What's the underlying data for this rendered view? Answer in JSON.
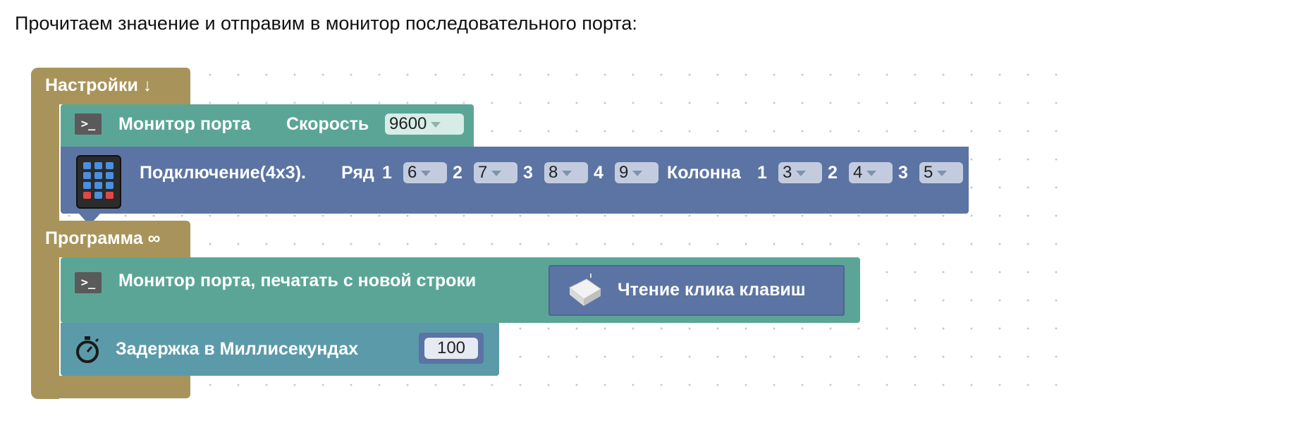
{
  "intro_text": "Прочитаем значение и отправим в монитор последовательного порта:",
  "setup": {
    "hat_label": "Настройки ↓",
    "serial": {
      "label": "Монитор порта",
      "speed_label": "Скорость",
      "speed_value": "9600"
    },
    "keypad": {
      "label": "Подключение(4x3).",
      "row_label": "Ряд",
      "rows": [
        {
          "n": "1",
          "pin": "6"
        },
        {
          "n": "2",
          "pin": "7"
        },
        {
          "n": "3",
          "pin": "8"
        },
        {
          "n": "4",
          "pin": "9"
        }
      ],
      "col_label": "Колонна",
      "cols": [
        {
          "n": "1",
          "pin": "3"
        },
        {
          "n": "2",
          "pin": "4"
        },
        {
          "n": "3",
          "pin": "5"
        }
      ]
    }
  },
  "program": {
    "hat_label": "Программа ∞",
    "print_label": "Монитор порта, печатать с новой строки",
    "read_key_label": "Чтение клика клавиш",
    "delay_label": "Задержка в Миллисекундах",
    "delay_value": "100"
  },
  "colors": {
    "hat": "#a8945a",
    "serial": "#5ba597",
    "keypad": "#5b74a3",
    "delay": "#5b9aa9",
    "field": "#c9d6e6"
  }
}
